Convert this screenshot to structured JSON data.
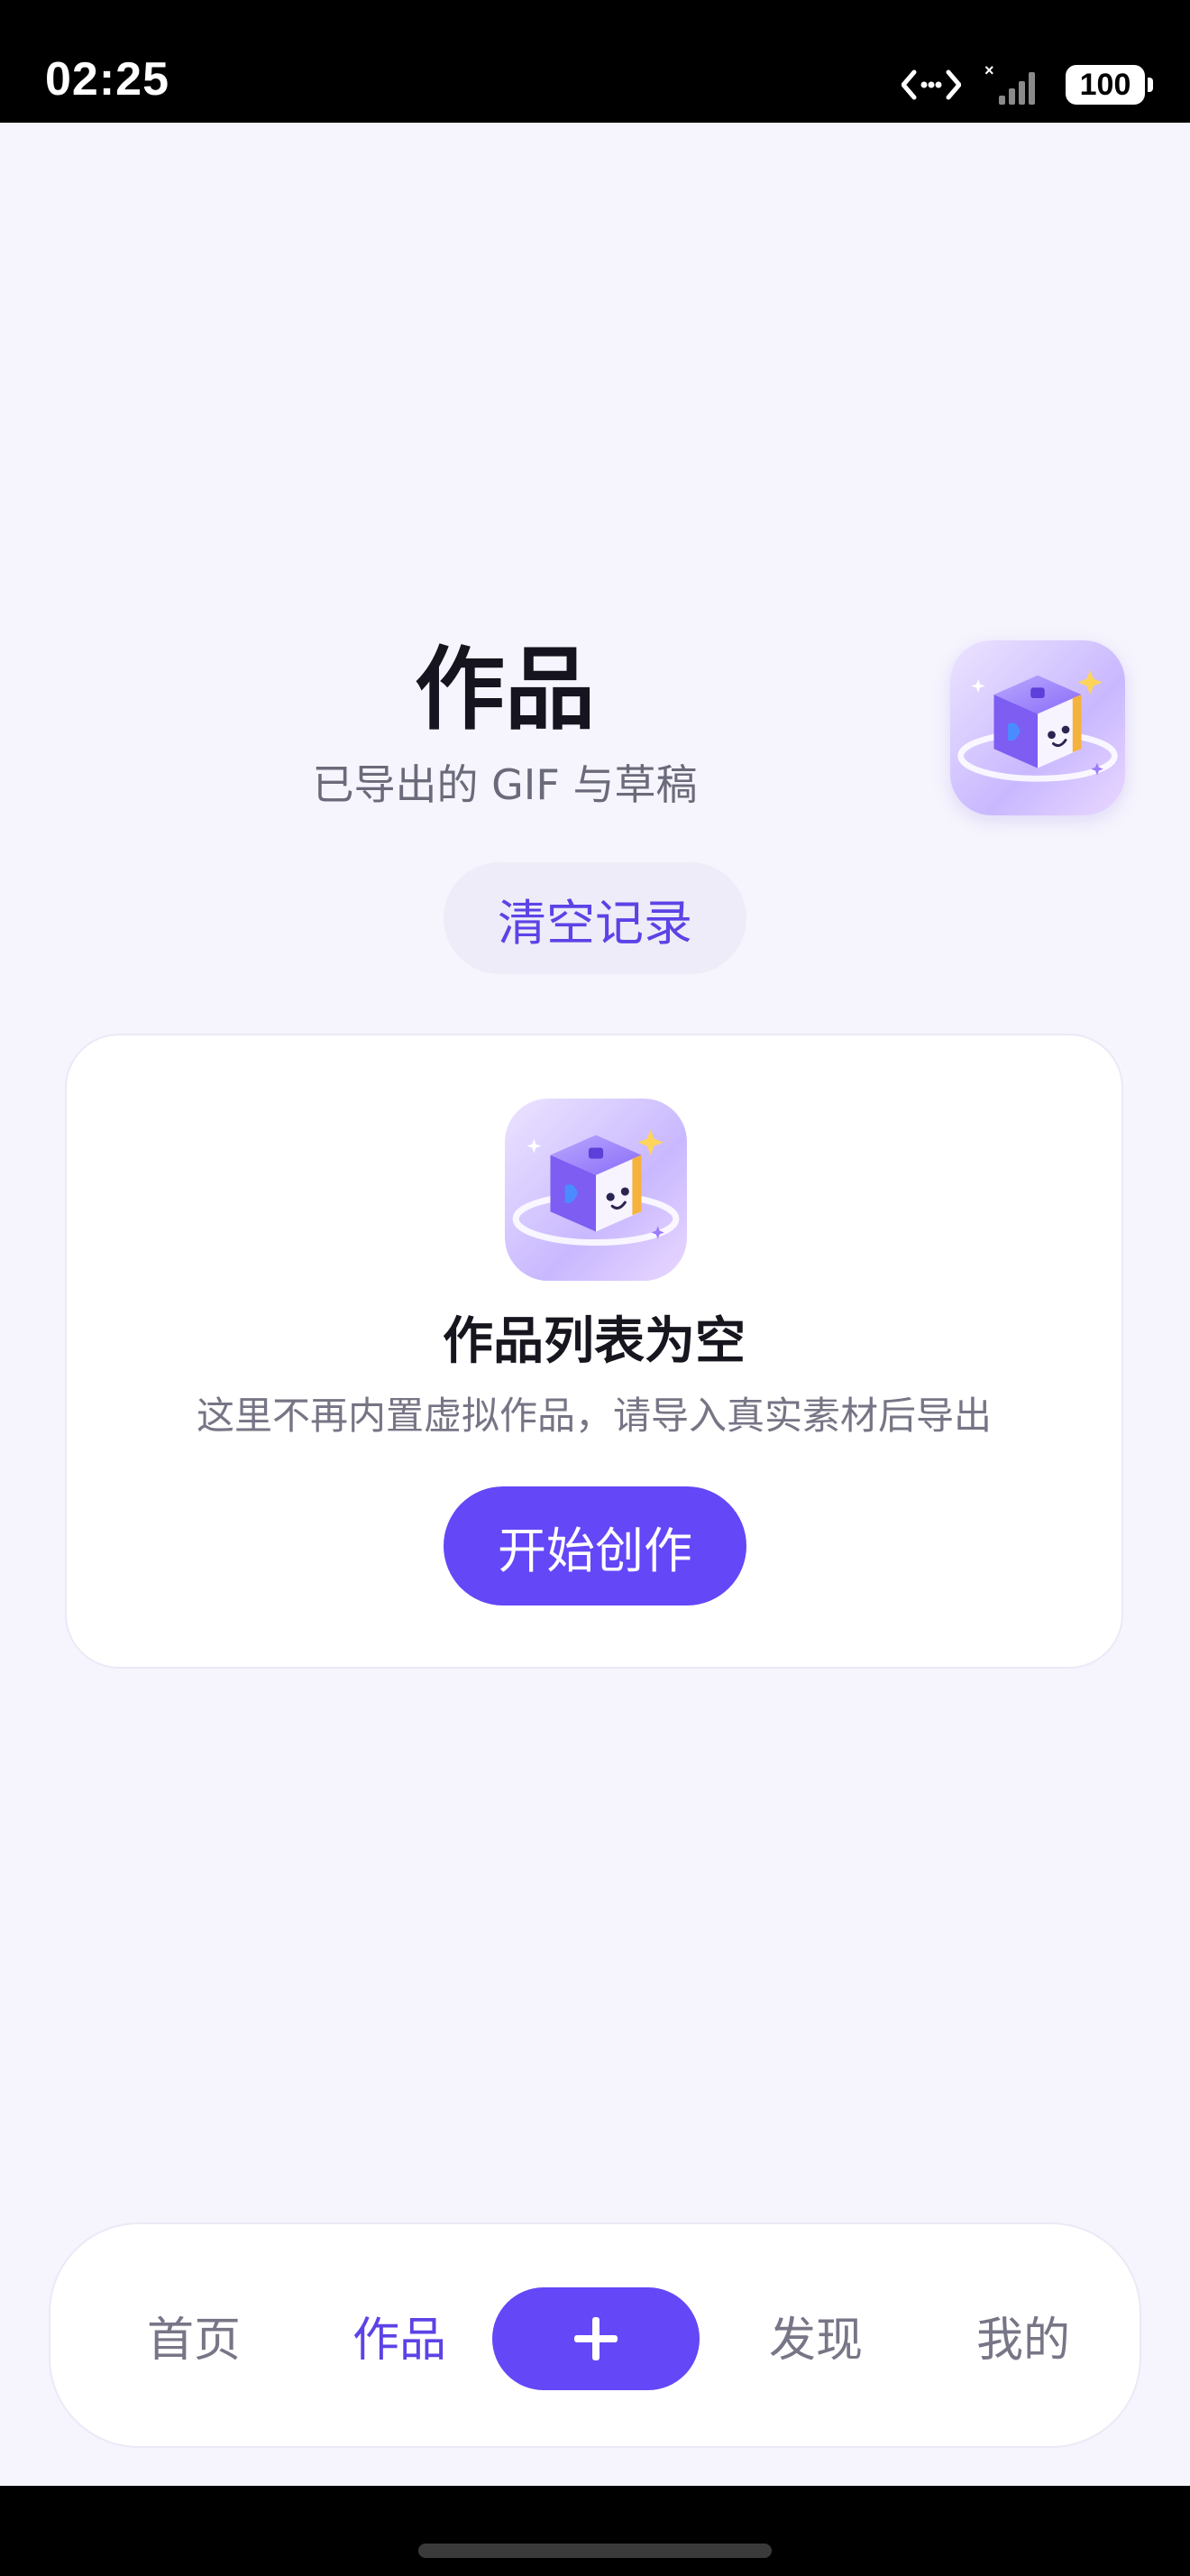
{
  "status_bar": {
    "time": "02:25",
    "battery": "100",
    "icons": [
      "network-arrows-icon",
      "no-signal-icon",
      "battery-icon"
    ]
  },
  "header": {
    "title": "作品",
    "subtitle": "已导出的 GIF 与草稿",
    "clear_label": "清空记录",
    "logo_icon": "app-logo-cube-icon"
  },
  "empty_state": {
    "title": "作品列表为空",
    "description": "这里不再内置虚拟作品，请导入真实素材后导出",
    "action_label": "开始创作",
    "icon": "app-logo-cube-icon"
  },
  "bottom_nav": {
    "items": [
      {
        "label": "首页",
        "active": false
      },
      {
        "label": "作品",
        "active": true
      },
      {
        "label": "发现",
        "active": false
      },
      {
        "label": "我的",
        "active": false
      }
    ],
    "add_icon": "plus-icon"
  },
  "colors": {
    "accent": "#6447f7",
    "accent_text": "#5b43e6",
    "background": "#f6f5fd",
    "chip_bg": "#eeecf8"
  }
}
